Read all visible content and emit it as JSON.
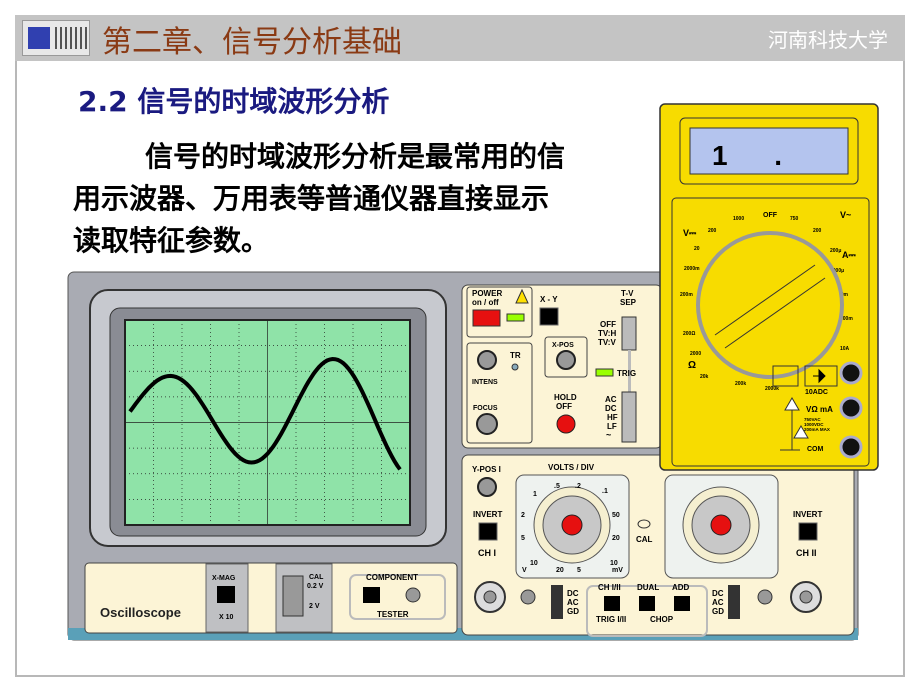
{
  "header": {
    "title": "第二章、信号分析基础",
    "university": "河南科技大学"
  },
  "section": {
    "heading": "2.2 信号的时域波形分析",
    "lines": [
      "信号的时域波形分析是最常用的信",
      "用示波器、万用表等普通仪器直接显示",
      "读取特征参数。"
    ]
  },
  "oscilloscope": {
    "name": "Oscilloscope",
    "power": "POWER",
    "onoff": "on / off",
    "xy": "X - Y",
    "tvsep1": "T-V",
    "tvsep2": "SEP",
    "tv_opts": [
      "OFF",
      "TV:H",
      "TV:V"
    ],
    "tr": "TR",
    "intens": "INTENS",
    "focus": "FOCUS",
    "xpos": "X-POS",
    "trig": "TRIG",
    "hold1": "HOLD",
    "hold2": "OFF",
    "coupling_opts": [
      "AC",
      "DC",
      "HF",
      "LF",
      "~"
    ],
    "ypos": "Y-POS I",
    "volts_div": "VOLTS / DIV",
    "invert": "INVERT",
    "ch1": "CH I",
    "ch2": "CH II",
    "cal": "CAL",
    "dial_labels": [
      ".5",
      ".2",
      ".1",
      "50",
      "20",
      "10",
      "mV",
      "5",
      "20",
      "10",
      "V",
      "5",
      "2",
      "1"
    ],
    "input_opts": [
      "DC",
      "AC",
      "GD"
    ],
    "ch12": "CH I/II",
    "dual": "DUAL",
    "add": "ADD",
    "trig12": "TRIG I/II",
    "chop": "CHOP",
    "xmag": "X-MAG",
    "x10": "X 10",
    "cal2": "CAL",
    "v02": "0.2 V",
    "v2": "2 V",
    "component": "COMPONENT",
    "tester": "TESTER"
  },
  "multimeter": {
    "display": "1      .",
    "off": "OFF",
    "vdc": "V⎓",
    "vac": "V~",
    "amp": "A⎓",
    "ohm": "Ω",
    "ranges": [
      "1000",
      "200",
      "20",
      "2000m",
      "200m",
      "750",
      "200",
      "200μ",
      "2000μ",
      "20m",
      "200m",
      "10A",
      "200Ω",
      "2000",
      "20k",
      "200k",
      "2000k"
    ],
    "jack_10a": "10ADC",
    "jack_vma": "VΩ mA",
    "jack_com": "COM",
    "warn": [
      "750VAC",
      "1000VDC",
      "200mA MAX"
    ]
  },
  "colors": {
    "title": "#8a3a14",
    "heading": "#1a1a80",
    "screen": "#8fe3a8",
    "meter": "#f7dc00",
    "panel": "#fcf4d6"
  }
}
